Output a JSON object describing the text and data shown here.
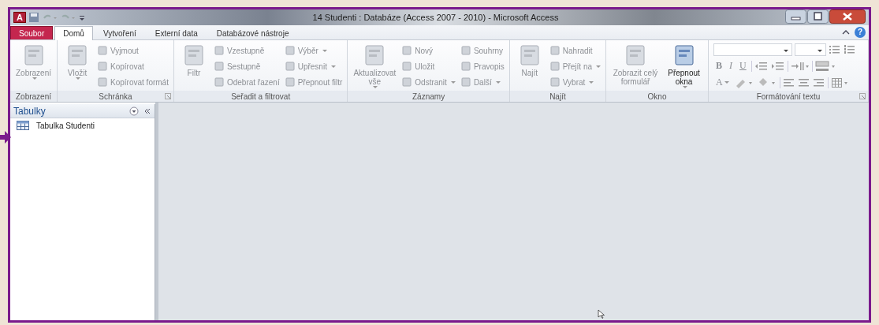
{
  "window": {
    "title": "14 Studenti : Databáze (Access 2007 - 2010)  -  Microsoft Access",
    "app_icon_letter": "A"
  },
  "tabs": [
    {
      "label": "Soubor",
      "kind": "file",
      "selected": false
    },
    {
      "label": "Domů",
      "kind": "tab",
      "selected": true
    },
    {
      "label": "Vytvoření",
      "kind": "tab",
      "selected": false
    },
    {
      "label": "Externí data",
      "kind": "tab",
      "selected": false
    },
    {
      "label": "Databázové nástroje",
      "kind": "tab",
      "selected": false
    }
  ],
  "help": "?",
  "ribbon": {
    "groups": [
      {
        "label": "Zobrazení",
        "launcher": false,
        "columns": [
          {
            "kind": "large",
            "items": [
              {
                "label": "Zobrazení",
                "disabled": true,
                "dropdown": true
              }
            ]
          }
        ]
      },
      {
        "label": "Schránka",
        "launcher": true,
        "columns": [
          {
            "kind": "large",
            "items": [
              {
                "label": "Vložit",
                "disabled": true,
                "dropdown": true
              }
            ]
          },
          {
            "kind": "small",
            "items": [
              {
                "label": "Vyjmout",
                "disabled": true,
                "dropdown": false
              },
              {
                "label": "Kopírovat",
                "disabled": true,
                "dropdown": false
              },
              {
                "label": "Kopírovat formát",
                "disabled": true,
                "dropdown": false
              }
            ]
          }
        ]
      },
      {
        "label": "Seřadit a filtrovat",
        "launcher": false,
        "columns": [
          {
            "kind": "large",
            "items": [
              {
                "label": "Filtr",
                "disabled": true,
                "dropdown": false
              }
            ]
          },
          {
            "kind": "small",
            "items": [
              {
                "label": "Vzestupně",
                "disabled": true,
                "dropdown": false
              },
              {
                "label": "Sestupně",
                "disabled": true,
                "dropdown": false
              },
              {
                "label": "Odebrat řazení",
                "disabled": true,
                "dropdown": false
              }
            ]
          },
          {
            "kind": "small",
            "items": [
              {
                "label": "Výběr",
                "disabled": true,
                "dropdown": true
              },
              {
                "label": "Upřesnit",
                "disabled": true,
                "dropdown": true
              },
              {
                "label": "Přepnout filtr",
                "disabled": true,
                "dropdown": false
              }
            ]
          }
        ]
      },
      {
        "label": "Záznamy",
        "launcher": false,
        "columns": [
          {
            "kind": "large",
            "items": [
              {
                "label": "Aktualizovat vše",
                "disabled": true,
                "dropdown": true
              }
            ]
          },
          {
            "kind": "small",
            "items": [
              {
                "label": "Nový",
                "disabled": true,
                "dropdown": false
              },
              {
                "label": "Uložit",
                "disabled": true,
                "dropdown": false
              },
              {
                "label": "Odstranit",
                "disabled": true,
                "dropdown": true
              }
            ]
          },
          {
            "kind": "small",
            "items": [
              {
                "label": "Souhrny",
                "disabled": true,
                "dropdown": false
              },
              {
                "label": "Pravopis",
                "disabled": true,
                "dropdown": false
              },
              {
                "label": "Další",
                "disabled": true,
                "dropdown": true
              }
            ]
          }
        ]
      },
      {
        "label": "Najít",
        "launcher": false,
        "columns": [
          {
            "kind": "large",
            "items": [
              {
                "label": "Najít",
                "disabled": true,
                "dropdown": false
              }
            ]
          },
          {
            "kind": "small",
            "items": [
              {
                "label": "Nahradit",
                "disabled": true,
                "dropdown": false
              },
              {
                "label": "Přejít na",
                "disabled": true,
                "dropdown": true
              },
              {
                "label": "Vybrat",
                "disabled": true,
                "dropdown": true
              }
            ]
          }
        ]
      },
      {
        "label": "Okno",
        "launcher": false,
        "columns": [
          {
            "kind": "large",
            "items": [
              {
                "label": "Zobrazit celý formulář",
                "disabled": true,
                "dropdown": false
              }
            ]
          },
          {
            "kind": "large",
            "items": [
              {
                "label": "Přepnout okna",
                "disabled": false,
                "dropdown": true
              }
            ]
          }
        ]
      },
      {
        "label": "Formátování textu",
        "launcher": true,
        "columns": [
          {
            "kind": "format",
            "items": [
              {
                "label": "B",
                "disabled": true,
                "dropdown": false
              },
              {
                "label": "I",
                "disabled": true,
                "dropdown": false
              },
              {
                "label": "U",
                "disabled": true,
                "dropdown": false
              },
              {
                "label": "A",
                "disabled": true,
                "dropdown": true
              }
            ]
          }
        ]
      }
    ]
  },
  "navigation_pane": {
    "title": "Tabulky",
    "items": [
      {
        "label": "Tabulka Studenti",
        "selected": false
      }
    ]
  }
}
